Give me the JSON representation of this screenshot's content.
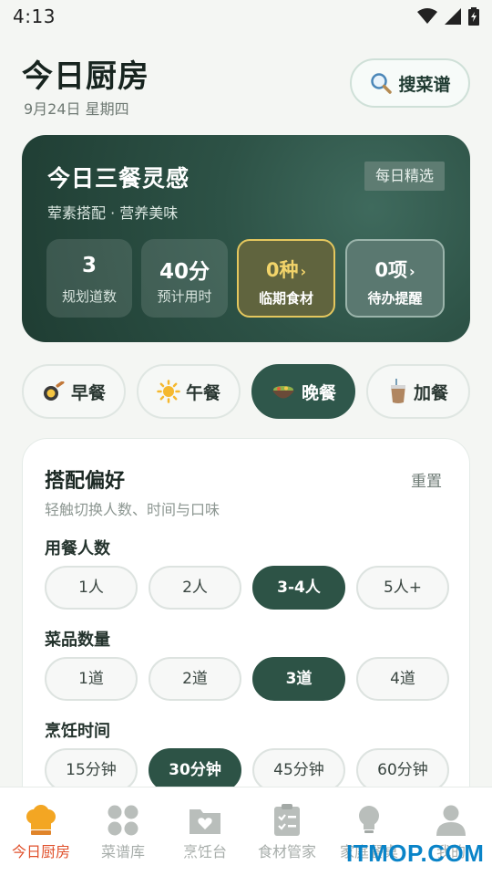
{
  "status_bar": {
    "time": "4:13"
  },
  "header": {
    "title": "今日厨房",
    "date": "9月24日 星期四",
    "search_label": "搜菜谱"
  },
  "hero": {
    "title": "今日三餐灵感",
    "subtitle": "荤素搭配 · 营养美味",
    "badge": "每日精选",
    "stats": [
      {
        "value": "3",
        "label": "规划道数"
      },
      {
        "value": "40分",
        "label": "预计用时"
      },
      {
        "value": "0种",
        "label": "临期食材"
      },
      {
        "value": "0项",
        "label": "待办提醒"
      }
    ]
  },
  "meals": [
    {
      "label": "早餐",
      "icon": "pan-icon"
    },
    {
      "label": "午餐",
      "icon": "sun-icon"
    },
    {
      "label": "晚餐",
      "icon": "bowl-icon",
      "active": true
    },
    {
      "label": "加餐",
      "icon": "drink-icon"
    }
  ],
  "preferences": {
    "title": "搭配偏好",
    "reset": "重置",
    "subtitle": "轻触切换人数、时间与口味",
    "people": {
      "label": "用餐人数",
      "options": [
        "1人",
        "2人",
        "3-4人",
        "5人+"
      ],
      "selected": "3-4人"
    },
    "dishes": {
      "label": "菜品数量",
      "options": [
        "1道",
        "2道",
        "3道",
        "4道"
      ],
      "selected": "3道"
    },
    "time": {
      "label": "烹饪时间",
      "options": [
        "15分钟",
        "30分钟",
        "45分钟",
        "60分钟"
      ],
      "selected": "30分钟"
    }
  },
  "tabs": [
    {
      "label": "今日厨房",
      "icon": "chef-hat-icon",
      "active": true
    },
    {
      "label": "菜谱库",
      "icon": "grid-icon"
    },
    {
      "label": "烹饪台",
      "icon": "folder-heart-icon"
    },
    {
      "label": "食材管家",
      "icon": "checklist-icon"
    },
    {
      "label": "家庭餐桌",
      "icon": "bulb-icon"
    },
    {
      "label": "我的",
      "icon": "user-icon"
    }
  ],
  "watermark": "ITMOP.COM",
  "colors": {
    "primary": "#2d5346",
    "accent_tab": "#e0512c",
    "highlight": "#e4c75e",
    "background": "#f4f6f3"
  }
}
